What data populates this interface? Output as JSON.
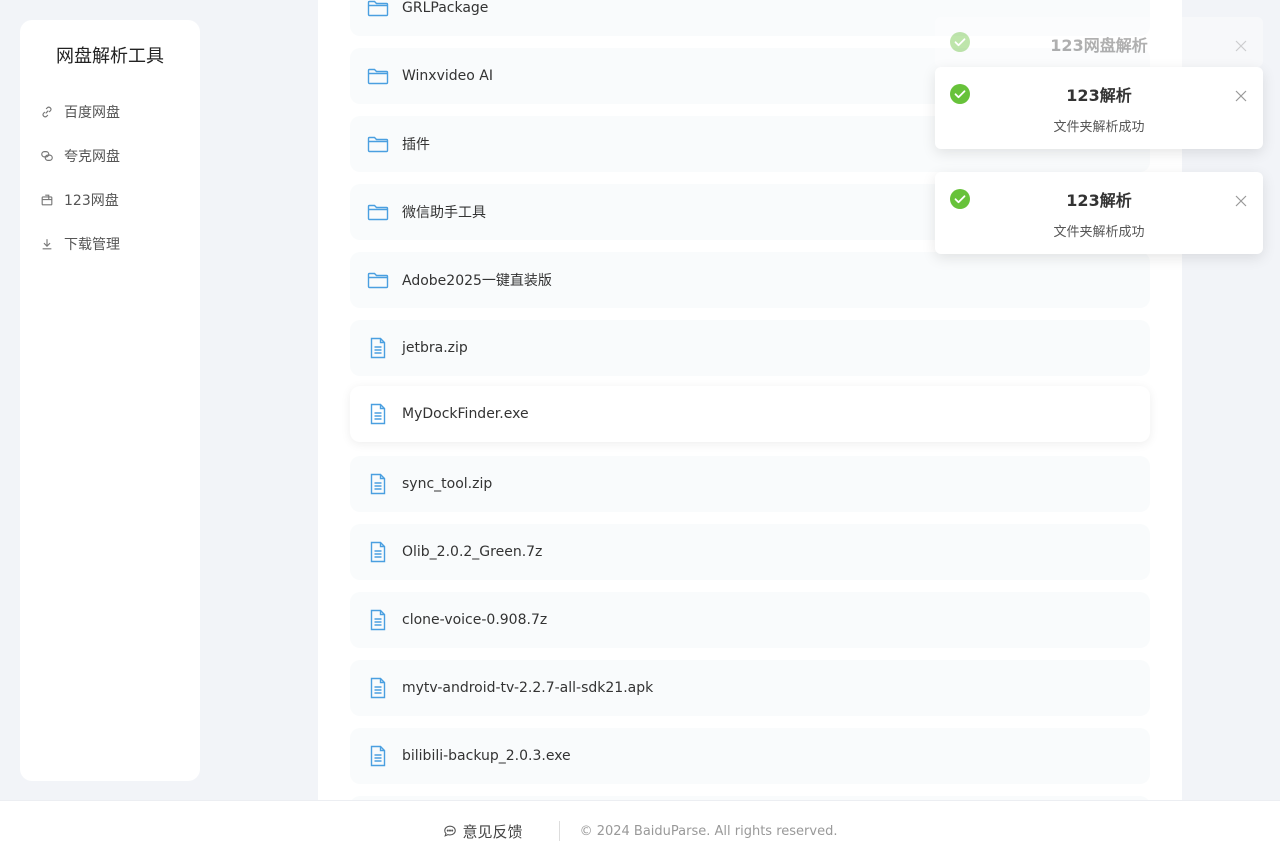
{
  "sidebar": {
    "title": "网盘解析工具",
    "items": [
      {
        "label": "百度网盘",
        "icon": "link-icon"
      },
      {
        "label": "夸克网盘",
        "icon": "chain-icon"
      },
      {
        "label": "123网盘",
        "icon": "box-icon"
      },
      {
        "label": "下载管理",
        "icon": "download-icon"
      }
    ]
  },
  "files": [
    {
      "name": "GRLPackage",
      "type": "folder"
    },
    {
      "name": "Winxvideo AI",
      "type": "folder"
    },
    {
      "name": "插件",
      "type": "folder"
    },
    {
      "name": "微信助手工具",
      "type": "folder"
    },
    {
      "name": "Adobe2025一键直装版",
      "type": "folder"
    },
    {
      "name": "jetbra.zip",
      "type": "file"
    },
    {
      "name": "MyDockFinder.exe",
      "type": "file"
    },
    {
      "name": "sync_tool.zip",
      "type": "file"
    },
    {
      "name": "Olib_2.0.2_Green.7z",
      "type": "file"
    },
    {
      "name": "clone-voice-0.908.7z",
      "type": "file"
    },
    {
      "name": "mytv-android-tv-2.2.7-all-sdk21.apk",
      "type": "file"
    },
    {
      "name": "bilibili-backup_2.0.3.exe",
      "type": "file"
    }
  ],
  "toasts": [
    {
      "title": "123网盘解析",
      "message": ""
    },
    {
      "title": "123解析",
      "message": "文件夹解析成功"
    },
    {
      "title": "123解析",
      "message": "文件夹解析成功"
    }
  ],
  "footer": {
    "feedback_label": "意见反馈",
    "copyright": "© 2024 BaiduParse. All rights reserved."
  },
  "colors": {
    "accent": "#4a9fe0",
    "success": "#67c23a",
    "background": "#f2f4f8"
  }
}
